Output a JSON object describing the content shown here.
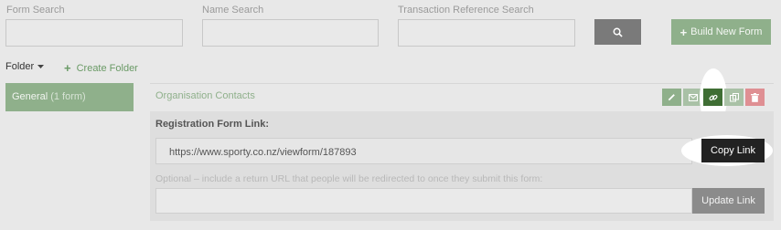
{
  "search": {
    "form_label": "Form Search",
    "name_label": "Name Search",
    "txn_label": "Transaction Reference Search",
    "form_value": "",
    "name_value": "",
    "txn_value": ""
  },
  "toolbar": {
    "build_label": "Build New Form",
    "folder_label": "Folder",
    "create_folder_label": "Create Folder"
  },
  "sidebar": {
    "items": [
      {
        "label": "General",
        "count": "(1 form)"
      }
    ]
  },
  "form": {
    "name": "Organisation Contacts",
    "actions": [
      "edit-icon",
      "email-icon",
      "link-icon",
      "copy-icon",
      "delete-icon"
    ]
  },
  "panel": {
    "title": "Registration Form Link:",
    "url": "https://www.sporty.co.nz/viewform/187893",
    "copy_label": "Copy Link",
    "optional_text": "Optional – include a return URL that people will be redirected to once they submit this form:",
    "return_url_value": "",
    "update_label": "Update Link"
  },
  "colors": {
    "accent_green": "#8fb08b",
    "dark_green": "#3f6e34",
    "delete_red": "#df8f93"
  }
}
